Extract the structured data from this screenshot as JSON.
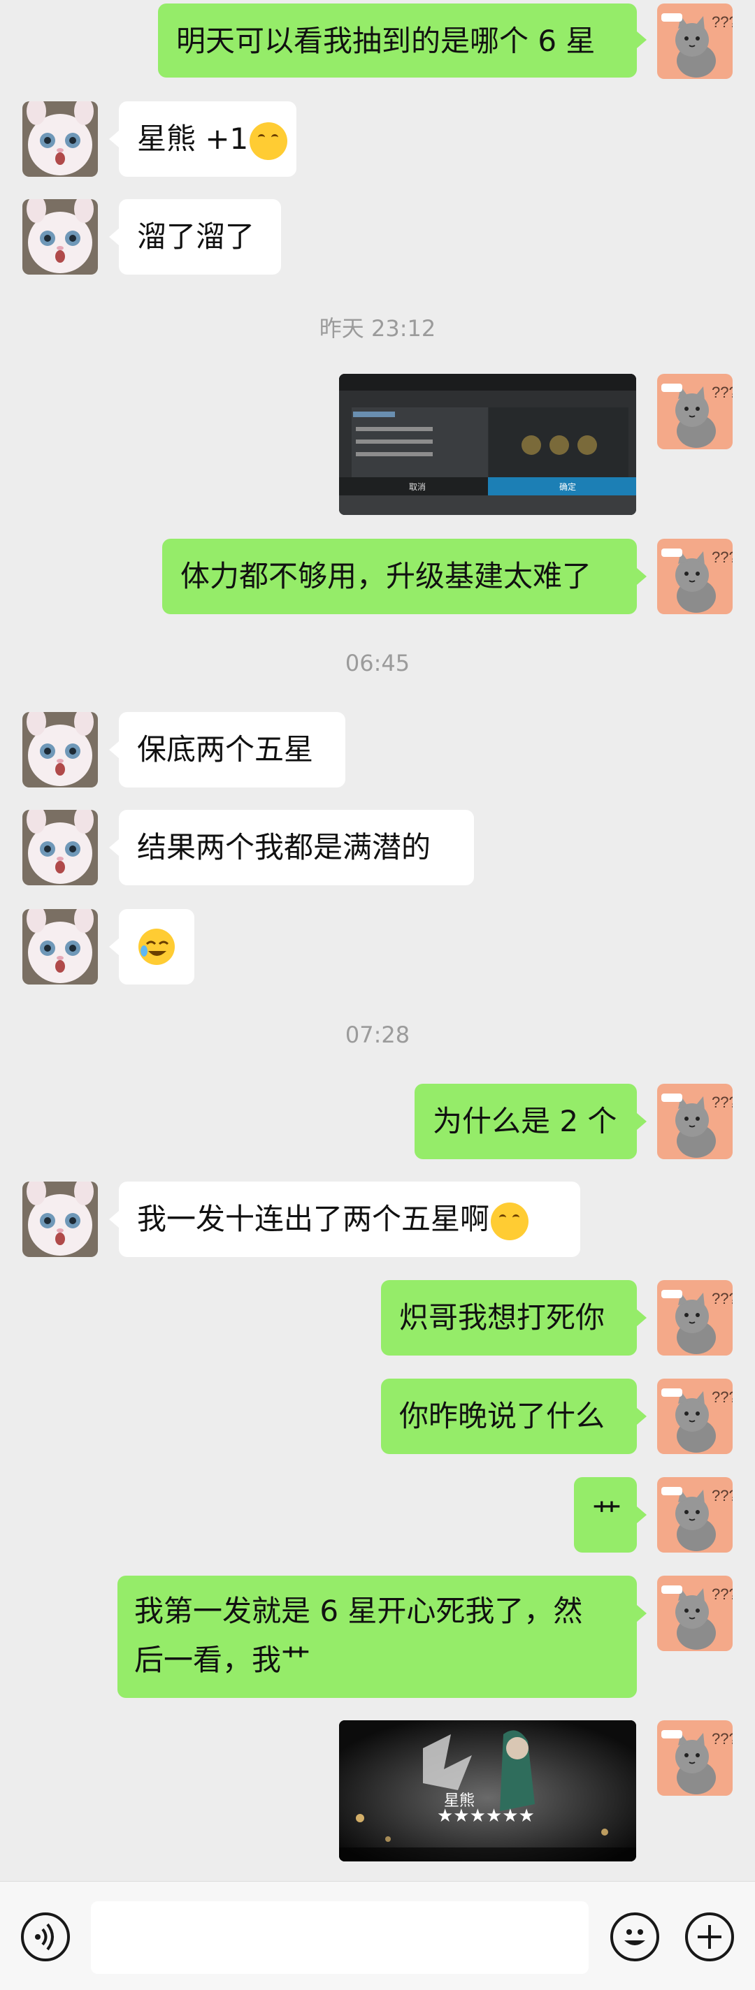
{
  "messages": {
    "m1": "明天可以看我抽到的是哪个 6 星",
    "m2": "星熊 +1",
    "m3": "溜了溜了",
    "m4": "体力都不够用，升级基建太难了",
    "m5": "保底两个五星",
    "m6": "结果两个我都是满潜的",
    "m7": "为什么是 2 个",
    "m8": "我一发十连出了两个五星啊",
    "m9": "炽哥我想打死你",
    "m10": "你昨晚说了什么",
    "m11": "艹",
    "m12_line1": "我第一发就是 6 星开心死我了，然",
    "m12_line2": "后一看，我艹"
  },
  "timestamps": {
    "t1": "昨天 23:12",
    "t2": "06:45",
    "t3": "07:28"
  },
  "image1": {
    "cancel": "取消",
    "confirm": "确定"
  },
  "image2": {
    "operator_name": "星熊",
    "stars": "★★★★★★"
  },
  "colors": {
    "self_bubble": "#95ec69",
    "other_bubble": "#ffffff",
    "background": "#ededed",
    "timestamp": "#9b9b9b"
  },
  "icons": {
    "voice": "voice-icon",
    "emoji": "emoji-icon",
    "plus": "plus-icon"
  }
}
